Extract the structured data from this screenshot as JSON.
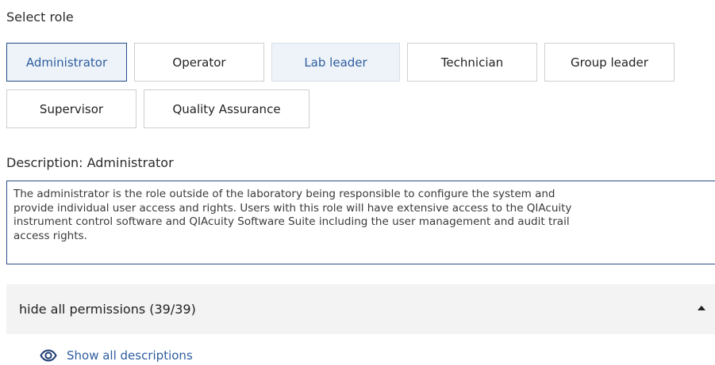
{
  "select_role_label": "Select role",
  "roles_row1": [
    "Administrator",
    "Operator",
    "Lab leader",
    "Technician",
    "Group leader"
  ],
  "roles_row2": [
    "Supervisor",
    "Quality Assurance"
  ],
  "selected_role": "Administrator",
  "description": {
    "title": "Description: Administrator",
    "lines": [
      "The administrator is the role outside of the laboratory being responsible to configure the system and",
      "provide individual user access and rights. Users with this role will have extensive access to the QIAcuity",
      "instrument control software and QIAcuity Software Suite including the user management and audit trail",
      "access rights."
    ]
  },
  "permissions": {
    "label": "hide all permissions (39/39)",
    "icon": "caret-up-icon"
  },
  "show_descriptions": {
    "label": "Show all descriptions",
    "icon": "eye-icon"
  },
  "colors": {
    "accent": "#2d5d9f",
    "selected_border": "#234a86",
    "selected_bg": "#eef3f9",
    "panel_bg": "#f3f3f3"
  }
}
